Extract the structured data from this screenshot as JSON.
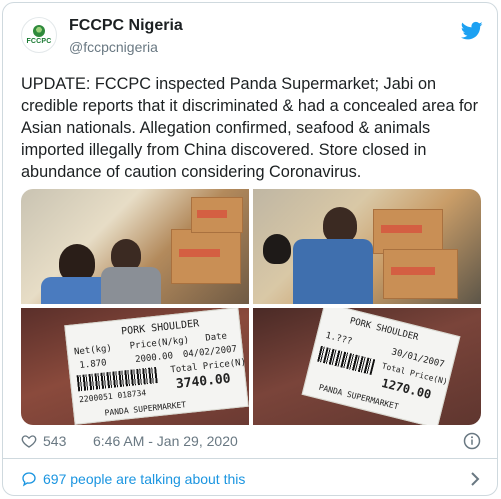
{
  "account": {
    "display_name": "FCCPC Nigeria",
    "handle": "@fccpcnigeria",
    "logo_text": "FCCPC"
  },
  "tweet": {
    "text": "UPDATE: FCCPC inspected  Panda Supermarket; Jabi on credible reports that it discriminated & had a concealed area for Asian nationals. Allegation confirmed, seafood & animals imported illegally from China discovered. Store closed in abundance of caution considering Coronavirus."
  },
  "photos": {
    "label_left": {
      "product": "PORK SHOULDER",
      "net_header": "Net(kg)",
      "price_header": "Price(N/kg)",
      "date_header": "Date",
      "net": "1.870",
      "price": "2000.00",
      "date": "04/02/2007",
      "total_label": "Total Price(N)",
      "total": "3740.00",
      "barcode_number": "2200051 018734",
      "store": "PANDA SUPERMARKET"
    },
    "label_right": {
      "product": "PORK SHOULDER",
      "net": "1.???",
      "date": "30/01/2007",
      "total_label": "Total Price(N)",
      "total": "1270.00",
      "store": "PANDA SUPERMARKET"
    }
  },
  "stats": {
    "likes": "543",
    "timestamp": "6:46 AM - Jan 29, 2020"
  },
  "footer": {
    "talking_text": "697 people are talking about this"
  },
  "colors": {
    "link_blue": "#1b95e0",
    "twitter_blue": "#1da1f2",
    "secondary_text": "#697882",
    "border": "#cfd9de"
  },
  "icons": [
    "twitter-bird-icon",
    "heart-icon",
    "info-icon",
    "speech-bubble-icon",
    "chevron-right-icon"
  ]
}
